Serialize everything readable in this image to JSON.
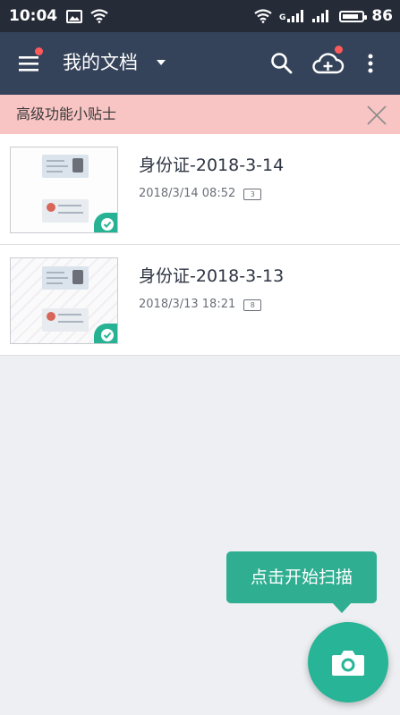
{
  "status_bar": {
    "time": "10:04",
    "signal_1": "ill",
    "signal_2": "ill",
    "battery": "86",
    "battery_level": 0.86
  },
  "app_bar": {
    "title": "我的文档"
  },
  "tips_banner": {
    "text": "高级功能小贴士"
  },
  "documents": [
    {
      "title": "身份证-2018-3-14",
      "datetime": "2018/3/14 08:52",
      "pages": "3"
    },
    {
      "title": "身份证-2018-3-13",
      "datetime": "2018/3/13 18:21",
      "pages": "8"
    }
  ],
  "scan_tip": {
    "text": "点击开始扫描"
  },
  "colors": {
    "app_bar": "#35435a",
    "status_bar": "#252b37",
    "accent": "#28b496",
    "tips_banner": "#f8c4c4",
    "badge_dot": "#ff5a5a"
  }
}
